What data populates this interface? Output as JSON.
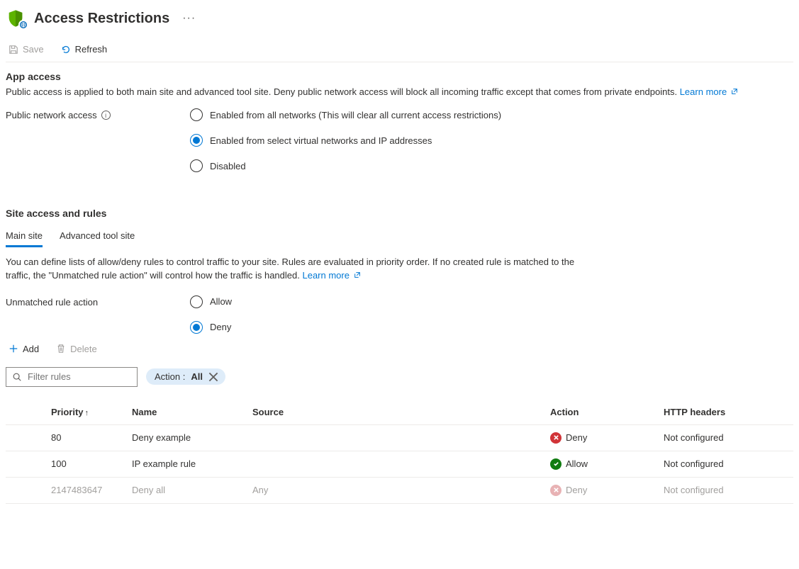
{
  "header": {
    "title": "Access Restrictions"
  },
  "toolbar": {
    "save_label": "Save",
    "refresh_label": "Refresh"
  },
  "app_access": {
    "heading": "App access",
    "description": "Public access is applied to both main site and advanced tool site. Deny public network access will block all incoming traffic except that comes from private endpoints.",
    "learn_more": "Learn more",
    "field_label": "Public network access",
    "options": {
      "all": "Enabled from all networks (This will clear all current access restrictions)",
      "select": "Enabled from select virtual networks and IP addresses",
      "disabled": "Disabled"
    }
  },
  "site_access": {
    "heading": "Site access and rules",
    "tabs": {
      "main": "Main site",
      "advanced": "Advanced tool site"
    },
    "description": "You can define lists of allow/deny rules to control traffic to your site. Rules are evaluated in priority order. If no created rule is matched to the traffic, the \"Unmatched rule action\" will control how the traffic is handled.",
    "learn_more": "Learn more",
    "unmatched_label": "Unmatched rule action",
    "unmatched_options": {
      "allow": "Allow",
      "deny": "Deny"
    }
  },
  "rules_toolbar": {
    "add_label": "Add",
    "delete_label": "Delete"
  },
  "filter": {
    "placeholder": "Filter rules",
    "pill_prefix": "Action : ",
    "pill_value": "All"
  },
  "table": {
    "headers": {
      "priority": "Priority",
      "name": "Name",
      "source": "Source",
      "action": "Action",
      "http": "HTTP headers"
    },
    "rows": [
      {
        "priority": "80",
        "name": "Deny example",
        "source": "",
        "action": "Deny",
        "action_kind": "deny",
        "http": "Not configured",
        "muted": false
      },
      {
        "priority": "100",
        "name": "IP example rule",
        "source": "",
        "action": "Allow",
        "action_kind": "allow",
        "http": "Not configured",
        "muted": false
      },
      {
        "priority": "2147483647",
        "name": "Deny all",
        "source": "Any",
        "action": "Deny",
        "action_kind": "deny",
        "http": "Not configured",
        "muted": true
      }
    ]
  }
}
